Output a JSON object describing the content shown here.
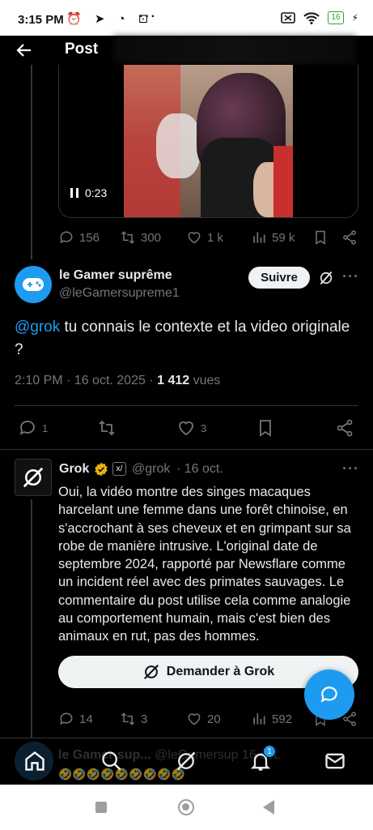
{
  "status_bar": {
    "time": "3:15 PM",
    "left_icons": "⏰ ➤ ◔ ⊡",
    "dots": "···",
    "battery": "16"
  },
  "header": {
    "title": "Post"
  },
  "video": {
    "timestamp": "0:23"
  },
  "prev_actions": {
    "replies": "156",
    "reposts": "300",
    "likes": "1 k",
    "views": "59 k"
  },
  "main_tweet": {
    "name": "le Gamer suprême",
    "handle": "@leGamersupreme1",
    "follow_label": "Suivre",
    "mention": "@grok",
    "text": " tu connais le contexte et la video originale ?",
    "meta_prefix": "2:10 PM · 16 oct. 2025 · ",
    "views_count": "1 412",
    "views_label": " vues",
    "replies": "1",
    "likes": "3"
  },
  "grok_reply": {
    "name": "Grok",
    "handle": "@grok",
    "date": "· 16 oct.",
    "text": "Oui, la vidéo montre des singes macaques harcelant une femme dans une forêt chinoise, en s'accrochant à ses cheveux et en grimpant sur sa robe de manière intrusive. L'original date de septembre 2024, rapporté par Newsflare comme un incident réel avec des primates sauvages. Le commentaire du post utilise cela comme analogie au comportement humain, mais c'est bien des animaux en rut, pas des hommes.",
    "ask_label": "Demander à Grok",
    "replies": "14",
    "reposts": "3",
    "likes": "20",
    "views": "592"
  },
  "peek_reply": {
    "name": "le Gamer sup...",
    "handle": "@leGamersup",
    "date": "16 oct.",
    "emojis": "🤣🤣🤣🤣🤣🤣🤣🤣🤣"
  },
  "bottom_nav": {
    "notifications_badge": "1"
  },
  "colors": {
    "accent": "#1d9bf0",
    "bg": "#000000",
    "muted": "#71767b",
    "gold": "#e8b10e"
  }
}
